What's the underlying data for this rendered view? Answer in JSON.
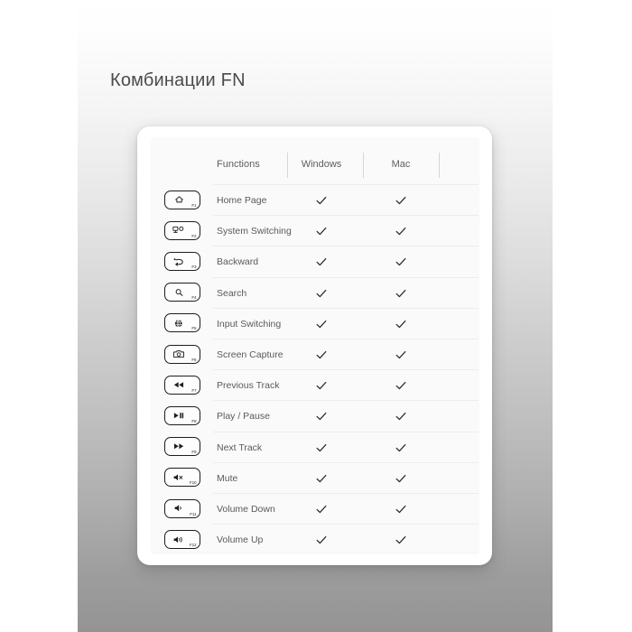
{
  "page": {
    "title": "Комбинации FN",
    "background_top_color": "#ffffff",
    "background_bottom_color": "#949494",
    "title_color": "#4b4b4b"
  },
  "table": {
    "headers": {
      "functions": "Functions",
      "windows": "Windows",
      "mac": "Mac"
    },
    "rows": [
      {
        "key": "F1",
        "icon": "home-icon",
        "function": "Home Page",
        "windows": "✓",
        "mac": "✓"
      },
      {
        "key": "F2",
        "icon": "window-switch-icon",
        "function": "System Switching",
        "windows": "✓",
        "mac": "✓"
      },
      {
        "key": "F3",
        "icon": "back-arrow-icon",
        "function": "Backward",
        "windows": "✓",
        "mac": "✓"
      },
      {
        "key": "F4",
        "icon": "search-icon",
        "function": "Search",
        "windows": "✓",
        "mac": "✓"
      },
      {
        "key": "F5",
        "icon": "globe-icon",
        "function": "Input Switching",
        "windows": "✓",
        "mac": "✓"
      },
      {
        "key": "F6",
        "icon": "camera-icon",
        "function": "Screen Capture",
        "windows": "✓",
        "mac": "✓"
      },
      {
        "key": "F7",
        "icon": "rewind-icon",
        "function": "Previous Track",
        "windows": "✓",
        "mac": "✓"
      },
      {
        "key": "F8",
        "icon": "play-pause-icon",
        "function": "Play / Pause",
        "windows": "✓",
        "mac": "✓"
      },
      {
        "key": "F9",
        "icon": "fast-forward-icon",
        "function": "Next Track",
        "windows": "✓",
        "mac": "✓"
      },
      {
        "key": "F10",
        "icon": "mute-icon",
        "function": "Mute",
        "windows": "✓",
        "mac": "✓"
      },
      {
        "key": "F11",
        "icon": "volume-down-icon",
        "function": "Volume Down",
        "windows": "✓",
        "mac": "✓"
      },
      {
        "key": "F12",
        "icon": "volume-up-icon",
        "function": "Volume Up",
        "windows": "✓",
        "mac": "✓"
      }
    ]
  }
}
